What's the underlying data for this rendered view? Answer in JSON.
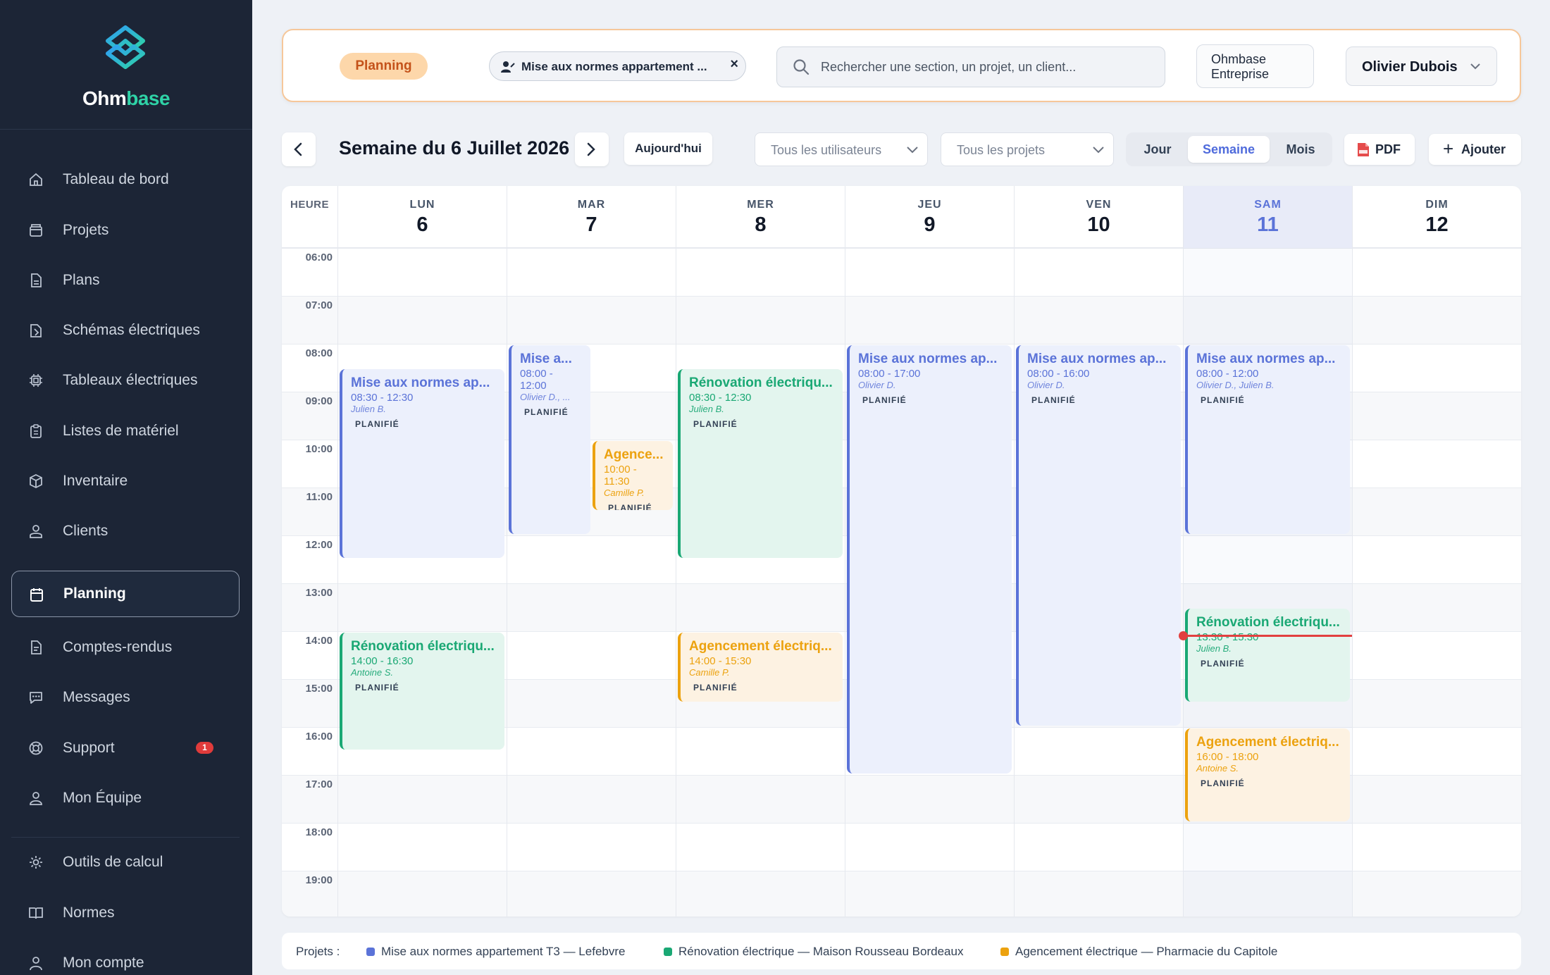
{
  "brand": {
    "part1": "Ohm",
    "part2": "base"
  },
  "sidebar": {
    "items": [
      {
        "label": "Tableau de bord",
        "icon": "home-icon"
      },
      {
        "label": "Projets",
        "icon": "folder-icon"
      },
      {
        "label": "Plans",
        "icon": "file-icon"
      },
      {
        "label": "Schémas électriques",
        "icon": "schema-icon"
      },
      {
        "label": "Tableaux électriques",
        "icon": "chip-icon"
      },
      {
        "label": "Listes de matériel",
        "icon": "clipboard-icon"
      },
      {
        "label": "Inventaire",
        "icon": "box-icon"
      },
      {
        "label": "Clients",
        "icon": "clients-icon"
      },
      {
        "label": "Planning",
        "icon": "calendar-icon",
        "active": true
      },
      {
        "label": "Comptes-rendus",
        "icon": "report-icon"
      },
      {
        "label": "Messages",
        "icon": "message-icon"
      },
      {
        "label": "Support",
        "icon": "lifebuoy-icon",
        "badge": "1"
      },
      {
        "label": "Mon Équipe",
        "icon": "team-icon"
      },
      {
        "label": "Outils de calcul",
        "icon": "gear-icon"
      },
      {
        "label": "Normes",
        "icon": "book-icon"
      },
      {
        "label": "Mon compte",
        "icon": "user-icon"
      }
    ]
  },
  "topbar": {
    "section_pill": "Planning",
    "filter_chip": "Mise aux normes appartement ...",
    "chip_close": "×",
    "search_placeholder": "Rechercher une section, un projet, un client...",
    "company_line1": "Ohmbase",
    "company_line2": "Entreprise",
    "user_name": "Olivier Dubois"
  },
  "toolbar": {
    "week_title": "Semaine du 6 Juillet 2026",
    "today_label": "Aujourd'hui",
    "users_filter": "Tous les utilisateurs",
    "projects_filter": "Tous les projets",
    "views": [
      "Jour",
      "Semaine",
      "Mois"
    ],
    "active_view": "Semaine",
    "pdf_label": "PDF",
    "add_plus": "+",
    "add_label": "Ajouter"
  },
  "calendar": {
    "hour_header": "HEURE",
    "hours": [
      "06:00",
      "07:00",
      "08:00",
      "09:00",
      "10:00",
      "11:00",
      "12:00",
      "13:00",
      "14:00",
      "15:00",
      "16:00",
      "17:00",
      "18:00",
      "19:00"
    ],
    "days": [
      {
        "name": "LUN",
        "num": "6"
      },
      {
        "name": "MAR",
        "num": "7"
      },
      {
        "name": "MER",
        "num": "8"
      },
      {
        "name": "JEU",
        "num": "9"
      },
      {
        "name": "VEN",
        "num": "10"
      },
      {
        "name": "SAM",
        "num": "11",
        "today": true
      },
      {
        "name": "DIM",
        "num": "12"
      }
    ],
    "current_time": "14:05",
    "events": [
      {
        "day": 0,
        "start": "08:30",
        "end": "12:30",
        "color": "blue",
        "title": "Mise aux normes ap...",
        "time": "08:30 - 12:30",
        "who": "Julien B.",
        "status": "PLANIFIÉ"
      },
      {
        "day": 0,
        "start": "14:00",
        "end": "16:30",
        "color": "green",
        "title": "Rénovation électriqu...",
        "time": "14:00 - 16:30",
        "who": "Antoine S.",
        "status": "PLANIFIÉ"
      },
      {
        "day": 1,
        "start": "08:00",
        "end": "12:00",
        "color": "blue",
        "title": "Mise a...",
        "time": "08:00 - 12:00",
        "who": "Olivier D., ...",
        "status": "PLANIFIÉ",
        "narrow": "left"
      },
      {
        "day": 1,
        "start": "10:00",
        "end": "11:30",
        "color": "orange",
        "title": "Agence...",
        "time": "10:00 - 11:30",
        "who": "Camille P.",
        "status": "PLANIFIÉ",
        "narrow": "right"
      },
      {
        "day": 2,
        "start": "08:30",
        "end": "12:30",
        "color": "green",
        "title": "Rénovation électriqu...",
        "time": "08:30 - 12:30",
        "who": "Julien B.",
        "status": "PLANIFIÉ"
      },
      {
        "day": 2,
        "start": "14:00",
        "end": "15:30",
        "color": "orange",
        "title": "Agencement électriq...",
        "time": "14:00 - 15:30",
        "who": "Camille P.",
        "status": "PLANIFIÉ"
      },
      {
        "day": 3,
        "start": "08:00",
        "end": "17:00",
        "color": "blue",
        "title": "Mise aux normes ap...",
        "time": "08:00 - 17:00",
        "who": "Olivier D.",
        "status": "PLANIFIÉ"
      },
      {
        "day": 4,
        "start": "08:00",
        "end": "16:00",
        "color": "blue",
        "title": "Mise aux normes ap...",
        "time": "08:00 - 16:00",
        "who": "Olivier D.",
        "status": "PLANIFIÉ"
      },
      {
        "day": 5,
        "start": "08:00",
        "end": "12:00",
        "color": "blue",
        "title": "Mise aux normes ap...",
        "time": "08:00 - 12:00",
        "who": "Olivier D., Julien B.",
        "status": "PLANIFIÉ"
      },
      {
        "day": 5,
        "start": "13:30",
        "end": "15:30",
        "color": "green",
        "title": "Rénovation électriqu...",
        "time": "13:30 - 15:30",
        "who": "Julien B.",
        "status": "PLANIFIÉ"
      },
      {
        "day": 5,
        "start": "16:00",
        "end": "18:00",
        "color": "orange",
        "title": "Agencement électriq...",
        "time": "16:00 - 18:00",
        "who": "Antoine S.",
        "status": "PLANIFIÉ"
      }
    ]
  },
  "legend": {
    "label": "Projets :",
    "items": [
      {
        "name": "Mise aux normes appartement T3 — Lefebvre",
        "color": "#5b73d8"
      },
      {
        "name": "Rénovation électrique — Maison Rousseau Bordeaux",
        "color": "#1aa874"
      },
      {
        "name": "Agencement électrique — Pharmacie du Capitole",
        "color": "#eca20f"
      }
    ]
  }
}
